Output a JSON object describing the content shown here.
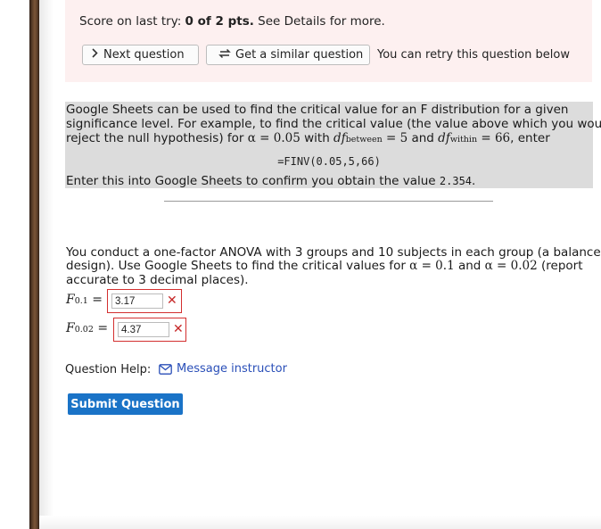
{
  "score": {
    "prefix": "Score on last try: ",
    "value": "0 of 2 pts.",
    "suffix": " See Details for more."
  },
  "buttons": {
    "next_question": "Next question",
    "similar_question": "Get a similar question",
    "retry_text": "You can retry this question below"
  },
  "intro": {
    "line1": "Google Sheets can be used to find the critical value for an F distribution for a given",
    "line2": "significance level.  For example, to find the critical value (the value above which you would",
    "line3_a": "reject the null hypothesis) for ",
    "alpha_eq": "α = 0.05",
    "line3_b": " with ",
    "df_between": "df",
    "df_between_sub": "between",
    "df_between_val": " = 5",
    "line3_c": " and ",
    "df_within": "df",
    "df_within_sub": "within",
    "df_within_val": " = 66",
    "line3_d": ", enter",
    "formula": "=FINV(0.05,5,66)",
    "confirm_a": "Enter this into Google Sheets to confirm you obtain the value ",
    "confirm_val": "2.354",
    "confirm_b": "."
  },
  "question": {
    "line1": "You conduct a one-factor ANOVA with 3 groups and 10 subjects in each group (a balanced",
    "line2_a": "design).  Use Google Sheets to find the critical values for ",
    "alpha1": "α = 0.1",
    "line2_b": " and ",
    "alpha2": "α = 0.02",
    "line2_c": " (report",
    "line3": "accurate to 3 decimal places)."
  },
  "answers": [
    {
      "label": "F",
      "sub": "0.1",
      "eq": " =",
      "value": "3.17",
      "status": "incorrect"
    },
    {
      "label": "F",
      "sub": "0.02",
      "eq": " =",
      "value": "4.37",
      "status": "incorrect"
    }
  ],
  "help": {
    "label": "Question Help:",
    "message_link": "Message instructor"
  },
  "submit_label": "Submit Question",
  "colors": {
    "score_bg": "#fdf0f0",
    "gray_box": "#dcdcdc",
    "error_red": "#d32f2f",
    "link_blue": "#2a4fb8",
    "submit_blue": "#1a73c7"
  },
  "icons": [
    "chevron-right-icon",
    "refresh-icon",
    "close-icon",
    "envelope-icon"
  ]
}
